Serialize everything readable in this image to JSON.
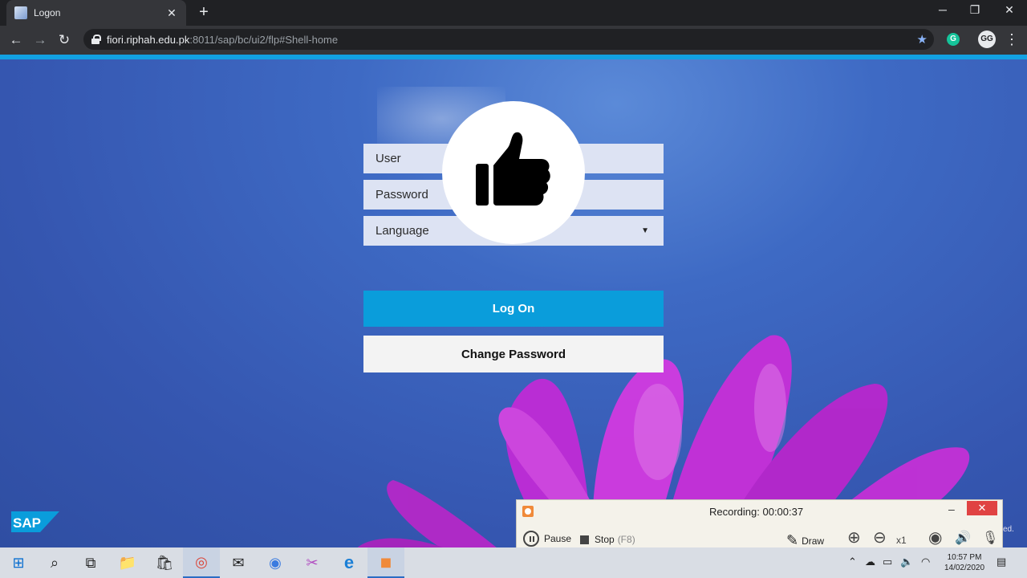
{
  "browser": {
    "tab_title": "Logon",
    "tab_close": "✕",
    "new_tab": "+",
    "win_min": "─",
    "win_restore": "❐",
    "win_close": "✕",
    "back": "←",
    "forward": "→",
    "reload": "↻",
    "url_host": "fiori.riphah.edu.pk",
    "url_path": ":8011/sap/bc/ui2/flp#Shell-home",
    "bookmark_star": "★",
    "extension_letter": "G",
    "profile_letters": "GG",
    "menu": "⋮"
  },
  "login": {
    "user_placeholder": "User",
    "password_placeholder": "Password",
    "language_placeholder": "Language",
    "language_caret": "▼",
    "logon_label": "Log On",
    "change_password_label": "Change Password"
  },
  "brand": {
    "logo_text": "SAP",
    "accent": "#0a9ddb"
  },
  "recorder": {
    "label": "Recording:  00:00:37",
    "minimize": "–",
    "close": "✕",
    "pause_label": "Pause",
    "stop_label": "Stop",
    "stop_hint": "(F8)",
    "draw_label": "Draw",
    "zoom_level": "x1",
    "draw_icon": "✎",
    "zoom_in_icon": "⊕",
    "zoom_out_icon": "⊖",
    "webcam_icon": "◉",
    "speaker_icon": "🔊",
    "mic_icon": "🎙"
  },
  "taskbar": {
    "start_icon": "⊞",
    "search_icon": "⌕",
    "taskview_icon": "⧉",
    "explorer_icon": "📁",
    "store_icon": "🛍",
    "chrome_icon": "◎",
    "mail_icon": "✉",
    "chromium_icon": "◉",
    "paint_icon": "✂",
    "edge_icon": "e",
    "recorder_icon": "◼",
    "tray_up": "⌃",
    "tray_cloud": "☁",
    "tray_battery": "▭",
    "tray_volume": "🔈",
    "tray_wifi": "◠",
    "notifications": "▤",
    "time": "10:57 PM",
    "date": "14/02/2020",
    "side_fragment": "ed."
  }
}
